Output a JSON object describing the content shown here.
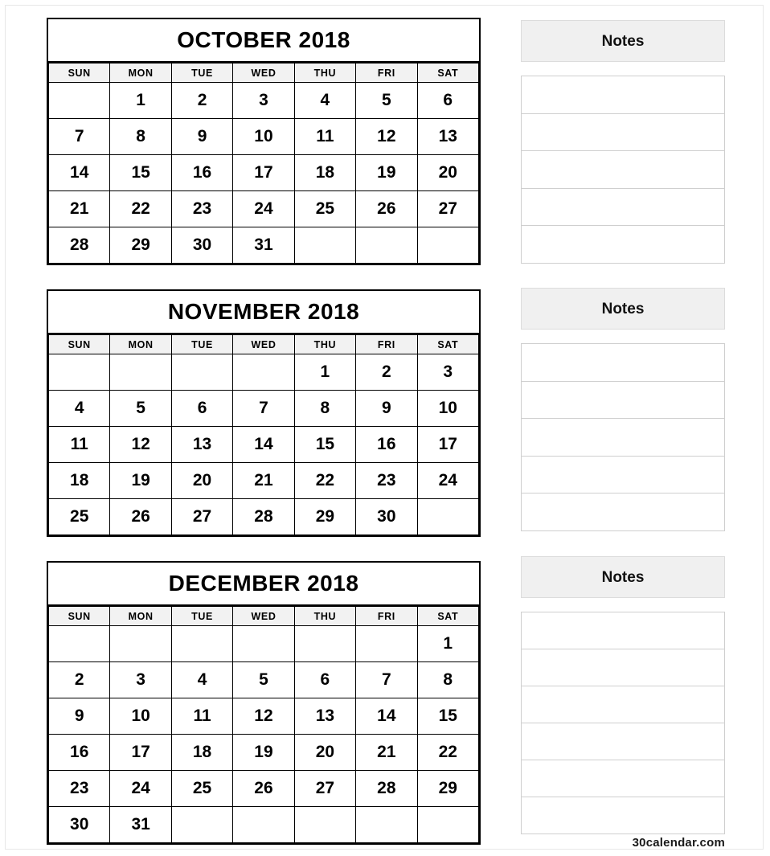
{
  "page": {
    "footer_text": "30calendar.com",
    "background": "#ffffff",
    "border_color": "#000000",
    "header_fill": "#f2f2f2",
    "notes_fill": "#f0f0f0"
  },
  "weekdays": [
    "SUN",
    "MON",
    "TUE",
    "WED",
    "THU",
    "FRI",
    "SAT"
  ],
  "months": [
    {
      "title": "OCTOBER 2018",
      "name": "October",
      "year": 2018,
      "start_weekday": "MON",
      "days_in_month": 31,
      "weeks": [
        [
          "",
          "1",
          "2",
          "3",
          "4",
          "5",
          "6"
        ],
        [
          "7",
          "8",
          "9",
          "10",
          "11",
          "12",
          "13"
        ],
        [
          "14",
          "15",
          "16",
          "17",
          "18",
          "19",
          "20"
        ],
        [
          "21",
          "22",
          "23",
          "24",
          "25",
          "26",
          "27"
        ],
        [
          "28",
          "29",
          "30",
          "31",
          "",
          "",
          ""
        ]
      ]
    },
    {
      "title": "NOVEMBER 2018",
      "name": "November",
      "year": 2018,
      "start_weekday": "THU",
      "days_in_month": 30,
      "weeks": [
        [
          "",
          "",
          "",
          "",
          "1",
          "2",
          "3"
        ],
        [
          "4",
          "5",
          "6",
          "7",
          "8",
          "9",
          "10"
        ],
        [
          "11",
          "12",
          "13",
          "14",
          "15",
          "16",
          "17"
        ],
        [
          "18",
          "19",
          "20",
          "21",
          "22",
          "23",
          "24"
        ],
        [
          "25",
          "26",
          "27",
          "28",
          "29",
          "30",
          ""
        ]
      ]
    },
    {
      "title": "DECEMBER 2018",
      "name": "December",
      "year": 2018,
      "start_weekday": "SAT",
      "days_in_month": 31,
      "weeks": [
        [
          "",
          "",
          "",
          "",
          "",
          "",
          "1"
        ],
        [
          "2",
          "3",
          "4",
          "5",
          "6",
          "7",
          "8"
        ],
        [
          "9",
          "10",
          "11",
          "12",
          "13",
          "14",
          "15"
        ],
        [
          "16",
          "17",
          "18",
          "19",
          "20",
          "21",
          "22"
        ],
        [
          "23",
          "24",
          "25",
          "26",
          "27",
          "28",
          "29"
        ],
        [
          "30",
          "31",
          "",
          "",
          "",
          "",
          ""
        ]
      ]
    }
  ],
  "notes_panels": [
    {
      "label": "Notes",
      "line_count": 5
    },
    {
      "label": "Notes",
      "line_count": 5
    },
    {
      "label": "Notes",
      "line_count": 6
    }
  ]
}
